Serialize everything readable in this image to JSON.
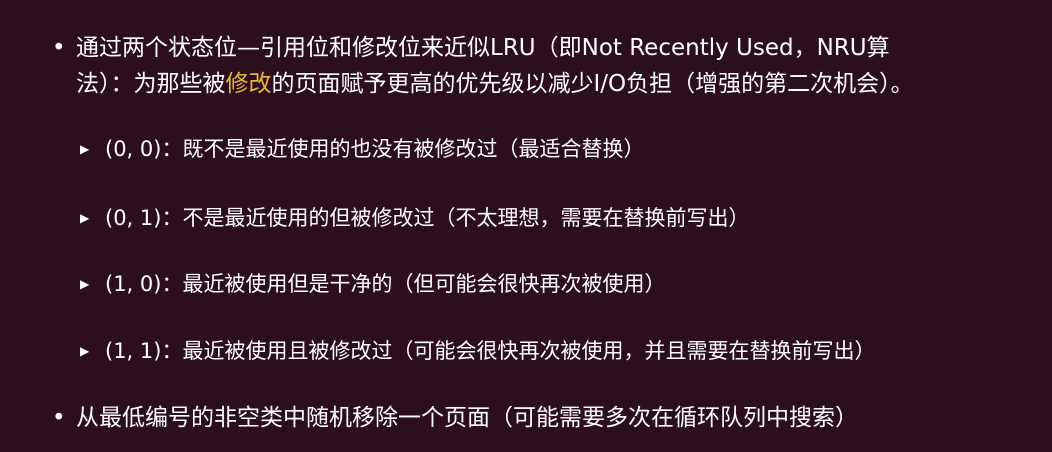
{
  "bullet1": {
    "line1": "通过两个状态位—引用位和修改位来近似LRU（即Not Recently Used，NRU算",
    "line2_prefix": "法）：为那些被",
    "line2_highlight": "修改",
    "line2_suffix": "的页面赋予更高的优先级以减少I/O负担（增强的第二次机会）。"
  },
  "sub_items": [
    {
      "text": "(0, 0)：既不是最近使用的也没有被修改过（最适合替换）"
    },
    {
      "text": "(0, 1)：不是最近使用的但被修改过（不太理想，需要在替换前写出）"
    },
    {
      "text": "(1, 0)：最近被使用但是干净的（但可能会很快再次被使用）"
    },
    {
      "text": "(1, 1)：最近被使用且被修改过（可能会很快再次被使用，并且需要在替换前写出）"
    }
  ],
  "bullet2": {
    "text": "从最低编号的非空类中随机移除一个页面（可能需要多次在循环队列中搜索）"
  },
  "colors": {
    "background": "#2c0e1f",
    "text": "#ffffff",
    "highlight": "#e6b933"
  },
  "icons": {
    "bullet": "bullet-dot-icon",
    "sub_bullet": "triangle-right-icon"
  }
}
